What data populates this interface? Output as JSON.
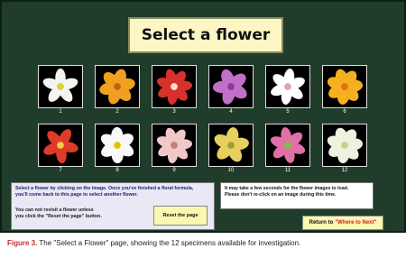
{
  "page": {
    "title": "Select a flower"
  },
  "flowers": [
    {
      "number": "1",
      "petal_color": "#f4f4f0",
      "center_color": "#d8d040"
    },
    {
      "number": "2",
      "petal_color": "#f0a020",
      "center_color": "#c46010"
    },
    {
      "number": "3",
      "petal_color": "#d8302a",
      "center_color": "#ffe0d0"
    },
    {
      "number": "4",
      "petal_color": "#c070c8",
      "center_color": "#8a3a9a"
    },
    {
      "number": "5",
      "petal_color": "#ffffff",
      "center_color": "#e0a0b0"
    },
    {
      "number": "6",
      "petal_color": "#f4b020",
      "center_color": "#e07010"
    },
    {
      "number": "7",
      "petal_color": "#e03a2a",
      "center_color": "#f0d040"
    },
    {
      "number": "8",
      "petal_color": "#f8f8f8",
      "center_color": "#e8c000"
    },
    {
      "number": "9",
      "petal_color": "#f0c8c8",
      "center_color": "#c08080"
    },
    {
      "number": "10",
      "petal_color": "#e8d060",
      "center_color": "#a0a030"
    },
    {
      "number": "11",
      "petal_color": "#e070a8",
      "center_color": "#80c040"
    },
    {
      "number": "12",
      "petal_color": "#f0f0e0",
      "center_color": "#c8d088"
    }
  ],
  "instructions": {
    "line1": "Select a flower by clicking on the image. Once you've finished a floral formula,",
    "line2": "you'll come back to this page to select another flower.",
    "line3": "You can not revisit a flower unless",
    "line4": "you click the \"Reset the page\" button."
  },
  "reset_button": {
    "label": "Reset the page"
  },
  "notice": {
    "line1": "It may take a few seconds for the flower images to load.",
    "line2": "Please don't re-click on an image during this time."
  },
  "return_button": {
    "prefix": "Return to",
    "link": "\"Where to Next\""
  },
  "caption": {
    "label": "Figure 3.",
    "text": " The \"Select a Flower\" page, showing the 12 specimens available for investigation."
  }
}
